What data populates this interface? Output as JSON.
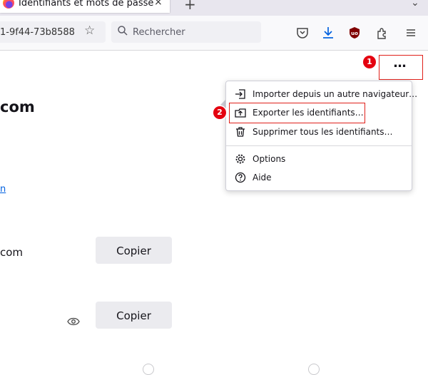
{
  "tab": {
    "title": "Identifiants et mots de passe",
    "close_glyph": "×",
    "new_tab_glyph": "+",
    "list_glyph": "⌄"
  },
  "navbar": {
    "url_fragment": "1-9f44-73b8588",
    "search_placeholder": "Rechercher"
  },
  "page": {
    "heading_fragment": "com",
    "link_fragment": "n",
    "field_fragment": "com",
    "copy_label_1": "Copier",
    "copy_label_2": "Copier"
  },
  "menu_button": {
    "label": "…"
  },
  "menu": {
    "items": [
      {
        "label": "Importer depuis un autre navigateur…",
        "icon": "import-icon"
      },
      {
        "label": "Exporter les identifiants…",
        "icon": "export-icon"
      },
      {
        "label": "Supprimer tous les identifiants…",
        "icon": "trash-icon"
      },
      {
        "label": "Options",
        "icon": "gear-icon"
      },
      {
        "label": "Aide",
        "icon": "help-icon"
      }
    ]
  },
  "annotations": {
    "step1": "1",
    "step2": "2",
    "highlight_color": "#e0201a"
  },
  "colors": {
    "accent": "#0060df",
    "ublock": "#800000",
    "download": "#0060df"
  }
}
